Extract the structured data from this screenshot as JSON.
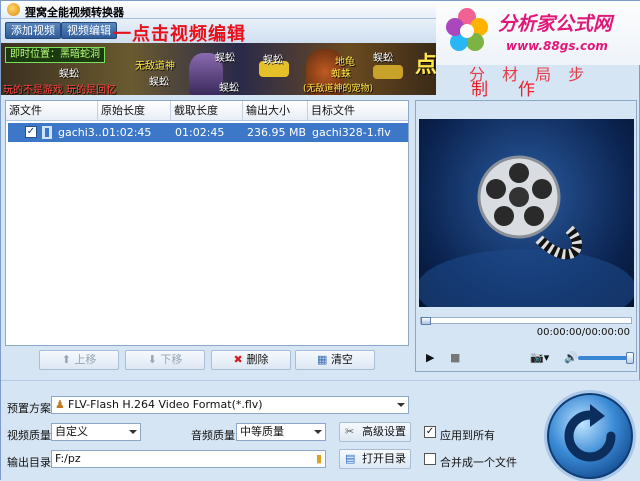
{
  "window": {
    "title": "狸窝全能视频转换器"
  },
  "toolbar": {
    "add_video": "添加视频",
    "edit_video": "视频编辑",
    "promo_text": "一点击视频编辑"
  },
  "banner": {
    "location": "即时位置：黑暗蛇洞",
    "labels": [
      "蜈蚣",
      "无敌道神",
      "蜈蚣",
      "蜈蚣",
      "蜈蚣",
      "蜘蛛",
      "地龟",
      "(无敌道神的宠物)",
      "蜈蚣",
      "蜈蚣"
    ],
    "footer": "玩的不是游戏 玩的是回忆",
    "tag": "点"
  },
  "logo": {
    "brand": "分析家公式网",
    "url": "www.88gs.com"
  },
  "side_note": {
    "line1": "分 材 局 步",
    "line2": "制作"
  },
  "file_list": {
    "headers": [
      "源文件",
      "原始长度",
      "截取长度",
      "输出大小",
      "目标文件"
    ],
    "rows": [
      {
        "checked": true,
        "source": "gachi3...",
        "original_length": "01:02:45",
        "clip_length": "01:02:45",
        "output_size": "236.95 MB",
        "target": "gachi328-1.flv"
      }
    ]
  },
  "list_tools": {
    "move_up": "上移",
    "move_down": "下移",
    "delete": "删除",
    "clear": "清空"
  },
  "preview": {
    "timecode": "00:00:00/00:00:00",
    "volume_level": 0.95,
    "position": 0
  },
  "settings": {
    "preset_label": "预置方案:",
    "preset_value": "FLV-Flash H.264 Video Format(*.flv)",
    "video_quality_label": "视频质量:",
    "video_quality_value": "自定义",
    "audio_quality_label": "音频质量:",
    "audio_quality_value": "中等质量",
    "advanced_settings": "高级设置",
    "apply_all": "应用到所有",
    "apply_all_checked": true,
    "output_dir_label": "输出目录:",
    "output_dir_value": "F:/pz",
    "open_dir": "打开目录",
    "merge_one": "合并成一个文件",
    "merge_checked": false
  },
  "colors": {
    "accent": "#3d78c8",
    "window_bg": "#d6e5f4",
    "promo_red": "#e8101a",
    "logo_pink": "#e0187a"
  }
}
